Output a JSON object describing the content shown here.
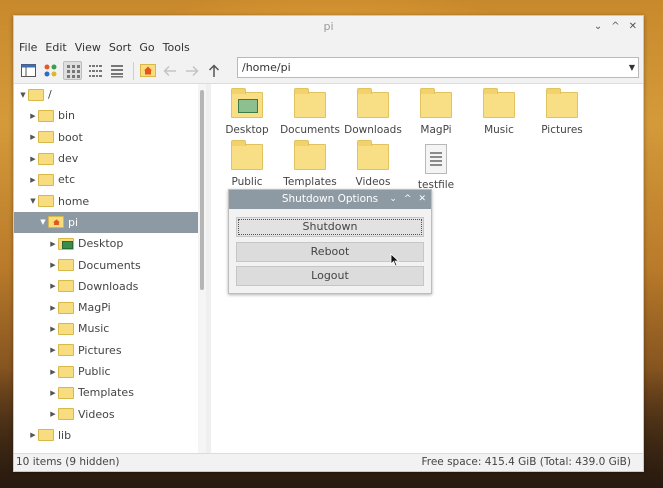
{
  "window": {
    "title": "pi",
    "controls": [
      "⌄",
      "^",
      "✕"
    ]
  },
  "menu": [
    "File",
    "Edit",
    "View",
    "Sort",
    "Go",
    "Tools"
  ],
  "toolbar": {
    "path": "/home/pi"
  },
  "tree": [
    {
      "label": "/",
      "level": 0,
      "expanded": true
    },
    {
      "label": "bin",
      "level": 1
    },
    {
      "label": "boot",
      "level": 1
    },
    {
      "label": "dev",
      "level": 1
    },
    {
      "label": "etc",
      "level": 1
    },
    {
      "label": "home",
      "level": 1,
      "expanded": true
    },
    {
      "label": "pi",
      "level": 2,
      "selected": true,
      "expanded": true,
      "icon": "home"
    },
    {
      "label": "Desktop",
      "level": 3,
      "icon": "desktop"
    },
    {
      "label": "Documents",
      "level": 3
    },
    {
      "label": "Downloads",
      "level": 3
    },
    {
      "label": "MagPi",
      "level": 3
    },
    {
      "label": "Music",
      "level": 3
    },
    {
      "label": "Pictures",
      "level": 3
    },
    {
      "label": "Public",
      "level": 3
    },
    {
      "label": "Templates",
      "level": 3
    },
    {
      "label": "Videos",
      "level": 3
    },
    {
      "label": "lib",
      "level": 1
    }
  ],
  "files": [
    {
      "label": "Desktop",
      "type": "desktop-folder"
    },
    {
      "label": "Documents",
      "type": "folder"
    },
    {
      "label": "Downloads",
      "type": "folder"
    },
    {
      "label": "MagPi",
      "type": "folder"
    },
    {
      "label": "Music",
      "type": "folder"
    },
    {
      "label": "Pictures",
      "type": "folder"
    },
    {
      "label": "Public",
      "type": "folder"
    },
    {
      "label": "Templates",
      "type": "folder"
    },
    {
      "label": "Videos",
      "type": "folder"
    },
    {
      "label": "testfile",
      "type": "text-file"
    }
  ],
  "status": {
    "left": "10 items (9 hidden)",
    "right": "Free space: 415.4 GiB (Total: 439.0 GiB)"
  },
  "dialog": {
    "title": "Shutdown Options",
    "buttons": [
      "Shutdown",
      "Reboot",
      "Logout"
    ]
  },
  "colors": {
    "selection": "#8e9aa3",
    "folder": "#f8dc80"
  }
}
